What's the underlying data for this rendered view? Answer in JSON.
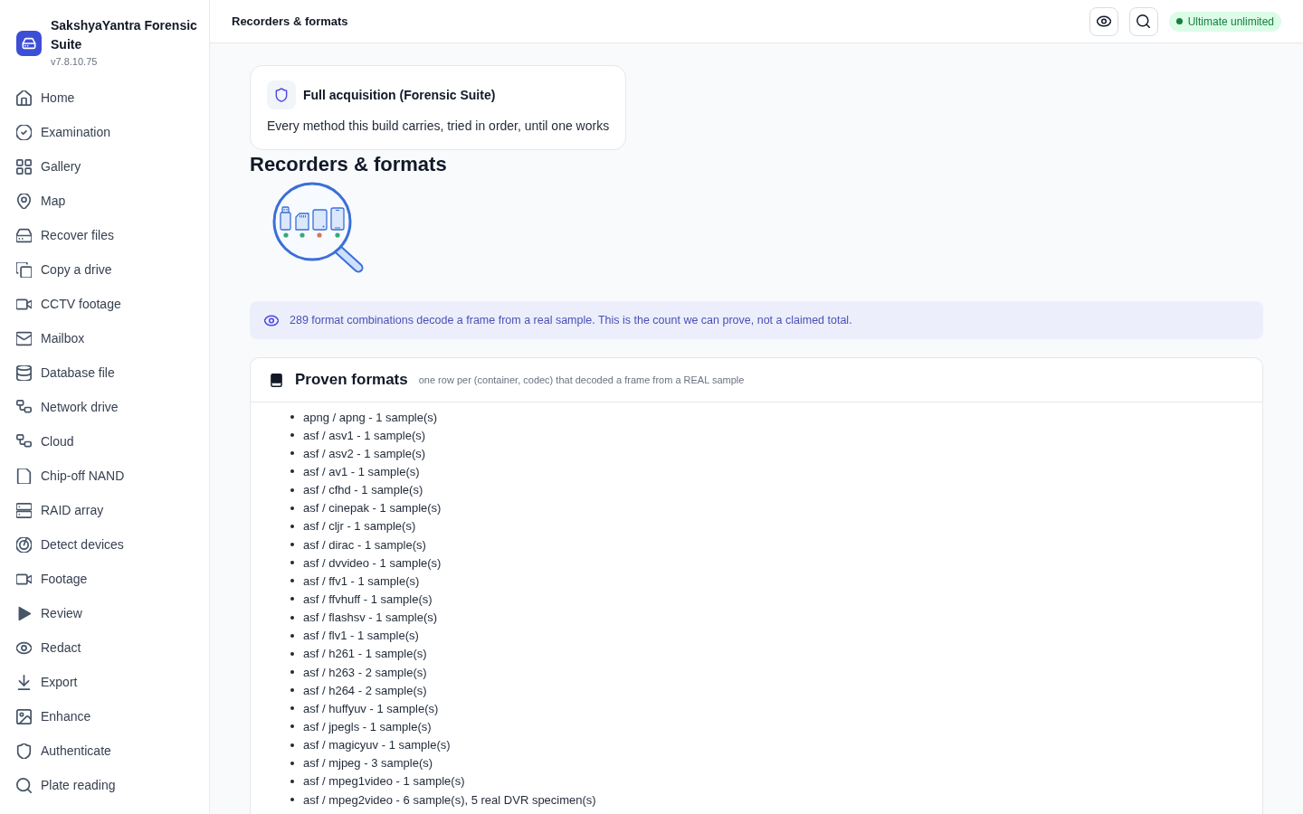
{
  "sidebar": {
    "app_name": "SakshyaYantra Forensic Suite",
    "version": "v7.8.10.75",
    "items": [
      {
        "label": "Home",
        "selected": false
      },
      {
        "label": "Examination",
        "selected": false
      },
      {
        "label": "Gallery",
        "selected": false
      },
      {
        "label": "Map",
        "selected": false
      },
      {
        "label": "Recover files",
        "selected": false
      },
      {
        "label": "Copy a drive",
        "selected": false
      },
      {
        "label": "CCTV footage",
        "selected": false
      },
      {
        "label": "Mailbox",
        "selected": false
      },
      {
        "label": "Database file",
        "selected": false
      },
      {
        "label": "Network drive",
        "selected": false
      },
      {
        "label": "Cloud",
        "selected": false
      },
      {
        "label": "Chip-off NAND",
        "selected": false
      },
      {
        "label": "RAID array",
        "selected": false
      },
      {
        "label": "Detect devices",
        "selected": false
      },
      {
        "label": "Footage",
        "selected": false
      },
      {
        "label": "Review",
        "selected": false
      },
      {
        "label": "Redact",
        "selected": false
      },
      {
        "label": "Export",
        "selected": false
      },
      {
        "label": "Enhance",
        "selected": false
      },
      {
        "label": "Authenticate",
        "selected": false
      },
      {
        "label": "Plate reading",
        "selected": false
      }
    ]
  },
  "header": {
    "title": "Recorders & formats",
    "license_badge": "Ultimate unlimited"
  },
  "method_card": {
    "title": "Full acquisition (Forensic Suite)",
    "description": "Every method this build carries, tried in order, until one works"
  },
  "page_heading": "Recorders & formats",
  "notice": "289 format combinations decode a frame from a real sample. This is the count we can prove, not a claimed total.",
  "proven_formats": {
    "title": "Proven formats",
    "subtitle": "one row per (container, codec) that decoded a frame from a REAL sample",
    "items": [
      "apng / apng - 1 sample(s)",
      "asf / asv1 - 1 sample(s)",
      "asf / asv2 - 1 sample(s)",
      "asf / av1 - 1 sample(s)",
      "asf / cfhd - 1 sample(s)",
      "asf / cinepak - 1 sample(s)",
      "asf / cljr - 1 sample(s)",
      "asf / dirac - 1 sample(s)",
      "asf / dvvideo - 1 sample(s)",
      "asf / ffv1 - 1 sample(s)",
      "asf / ffvhuff - 1 sample(s)",
      "asf / flashsv - 1 sample(s)",
      "asf / flv1 - 1 sample(s)",
      "asf / h261 - 1 sample(s)",
      "asf / h263 - 2 sample(s)",
      "asf / h264 - 2 sample(s)",
      "asf / huffyuv - 1 sample(s)",
      "asf / jpegls - 1 sample(s)",
      "asf / magicyuv - 1 sample(s)",
      "asf / mjpeg - 3 sample(s)",
      "asf / mpeg1video - 1 sample(s)",
      "asf / mpeg2video - 6 sample(s), 5 real DVR specimen(s)"
    ]
  }
}
